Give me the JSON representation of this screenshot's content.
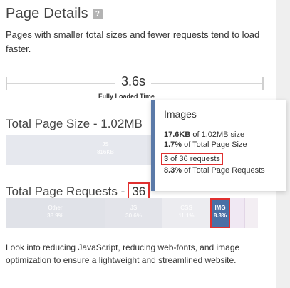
{
  "header": {
    "title": "Page Details",
    "help": "?"
  },
  "description": "Pages with smaller total sizes and fewer requests tend to load faster.",
  "timeline": {
    "value": "3.6s",
    "label": "Fully Loaded Time"
  },
  "page_size": {
    "title": "Total Page Size - 1.02MB",
    "segments": [
      {
        "label": "JS",
        "value": "816KB"
      }
    ]
  },
  "page_requests": {
    "title_prefix": "Total Page Requests - ",
    "count": "36",
    "segments": [
      {
        "label": "Other",
        "value": "38.9%"
      },
      {
        "label": "JS",
        "value": "30.6%"
      },
      {
        "label": "CSS",
        "value": "11.1%"
      },
      {
        "label": "IMG",
        "value": "8.3%"
      }
    ]
  },
  "tooltip": {
    "title": "Images",
    "size_value": "17.6KB",
    "size_rest": " of 1.02MB size",
    "size_pct": "1.7%",
    "size_pct_rest": " of Total Page Size",
    "req_value": "3",
    "req_rest": " of 36 requests",
    "req_pct": "8.3%",
    "req_pct_rest": " of Total Page Requests"
  },
  "footer": "Look into reducing JavaScript, reducing web-fonts, and image optimization to ensure a lightweight and streamlined website.",
  "colors": {
    "accent": "#5b7aa8",
    "highlight": "#e03030",
    "img_segment": "#4a6fa5"
  }
}
